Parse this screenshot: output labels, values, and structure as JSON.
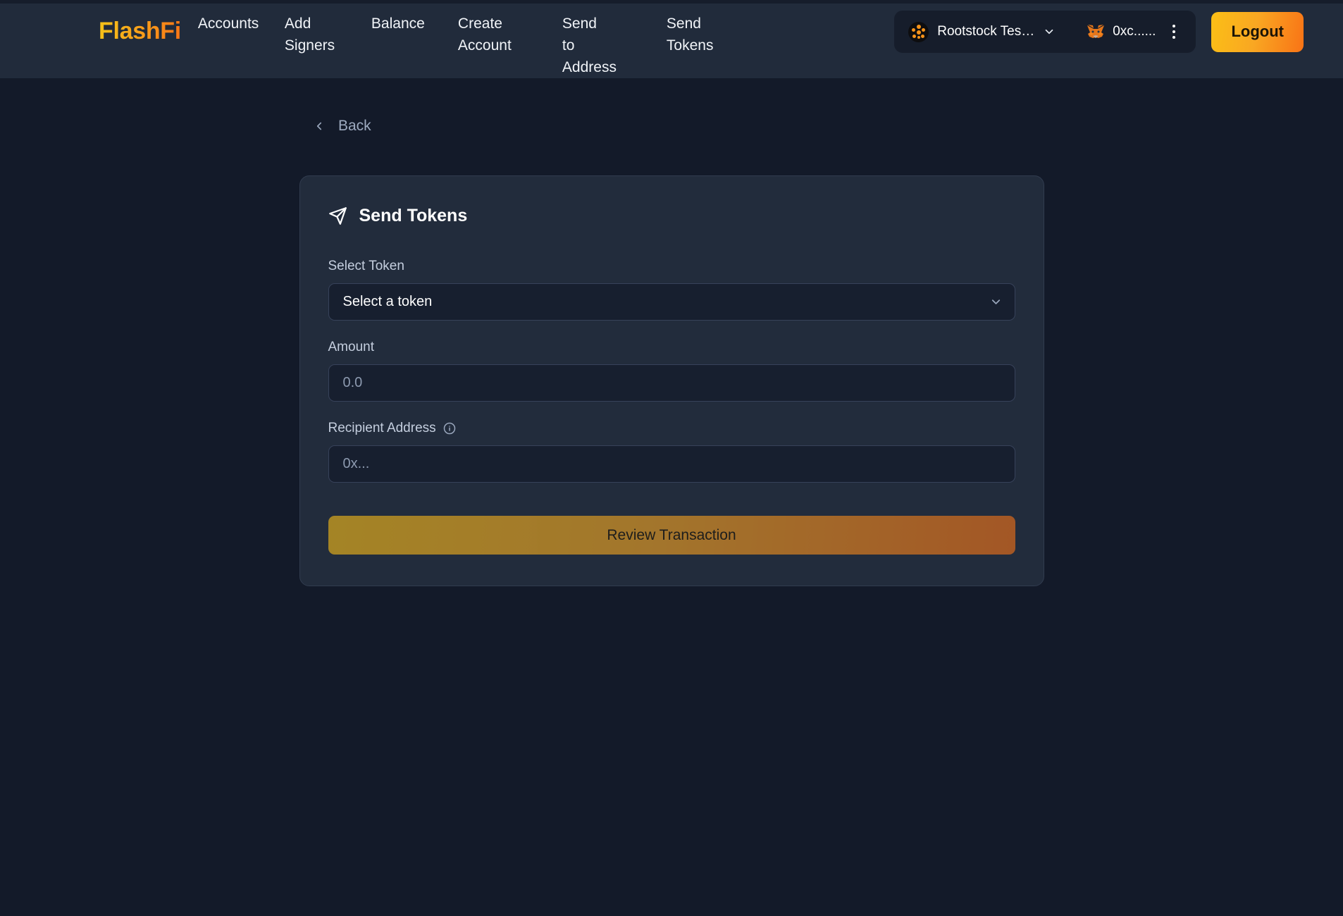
{
  "brand": {
    "name": "FlashFi"
  },
  "nav": {
    "items": [
      {
        "label": "Accounts",
        "name": "nav-accounts",
        "wide": false,
        "one_word": true
      },
      {
        "label": "Add Signers",
        "name": "nav-add-signers",
        "wide": false,
        "one_word": false
      },
      {
        "label": "Balance",
        "name": "nav-balance",
        "wide": false,
        "one_word": true
      },
      {
        "label": "Create Account",
        "name": "nav-create-account",
        "wide": true,
        "one_word": false
      },
      {
        "label": "Send to Address",
        "name": "nav-send-to-address",
        "wide": true,
        "one_word": false
      },
      {
        "label": "Send Tokens",
        "name": "nav-send-tokens",
        "wide": false,
        "one_word": false
      }
    ]
  },
  "header": {
    "network": {
      "label": "Rootstock Tes…",
      "icon": "rootstock-icon",
      "chevron": "chevron-down-icon"
    },
    "wallet": {
      "address": "0xc......",
      "icon": "metamask-fox-icon",
      "menu": "kebab-menu-icon"
    },
    "logout_label": "Logout"
  },
  "back": {
    "label": "Back",
    "icon": "chevron-left-icon"
  },
  "card": {
    "title": "Send Tokens",
    "title_icon": "send-paper-plane-icon",
    "select_token": {
      "label": "Select Token",
      "value": "Select a token",
      "chevron": "chevron-down-icon"
    },
    "amount": {
      "label": "Amount",
      "value": "",
      "placeholder": "0.0"
    },
    "recipient": {
      "label": "Recipient Address",
      "info_icon": "info-circle-icon",
      "value": "",
      "placeholder": "0x..."
    },
    "submit_label": "Review Transaction"
  },
  "colors": {
    "page_bg": "#131a29",
    "header_bg": "#212b3b",
    "card_bg": "#222c3c",
    "input_bg": "#171f2f",
    "accent_start": "#fbbf16",
    "accent_end": "#f97316",
    "muted_text": "#9aa7bd"
  }
}
